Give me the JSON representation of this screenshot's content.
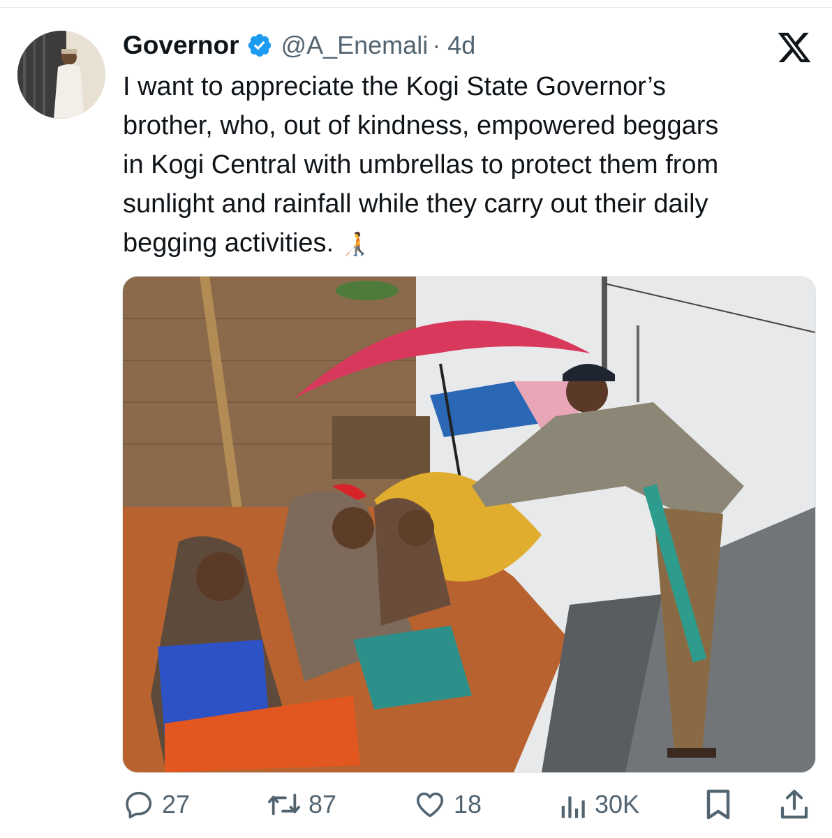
{
  "tweet": {
    "display_name": "Governor",
    "handle": "@A_Enemali",
    "time": "· 4d",
    "text": "I want to appreciate the Kogi State Governor’s\nbrother, who, out of kindness, empowered beggars\nin Kogi Central with umbrellas to protect them from\nsunlight and rainfall while they carry out their daily\nbegging activities.",
    "emoji": "🧑‍🦯"
  },
  "metrics": {
    "replies": "27",
    "reposts": "87",
    "likes": "18",
    "views": "30K"
  },
  "colors": {
    "verified": "#1d9bf0",
    "secondary_text": "#536471",
    "primary_text": "#0f1419"
  },
  "icons": [
    "x-logo-icon",
    "verified-badge-icon",
    "reply-icon",
    "repost-icon",
    "like-icon",
    "views-icon",
    "bookmark-icon",
    "share-icon"
  ]
}
